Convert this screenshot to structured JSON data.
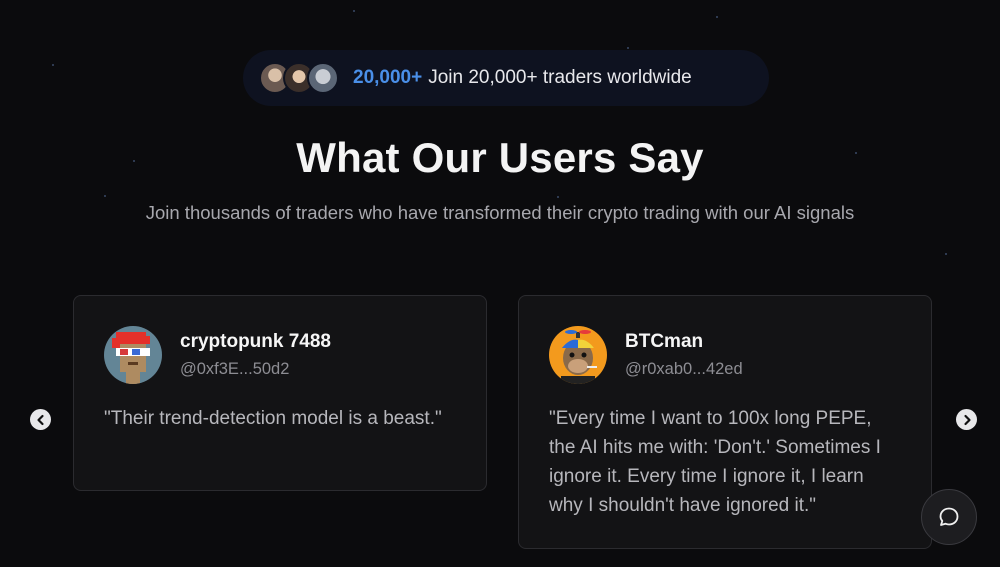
{
  "badge": {
    "count": "20,000+",
    "text": "Join 20,000+ traders worldwide",
    "avatars": [
      "user-avatar-1",
      "user-avatar-2",
      "user-avatar-3"
    ]
  },
  "heading": {
    "title": "What Our Users Say",
    "subtitle": "Join thousands of traders who have transformed their crypto trading with our AI signals"
  },
  "testimonials": [
    {
      "name": "cryptopunk 7488",
      "handle": "@0xf3E...50d2",
      "quote": "\"Their trend-detection model is a beast.\""
    },
    {
      "name": "BTCman",
      "handle": "@r0xab0...42ed",
      "quote": "\"Every time I want to 100x long PEPE, the AI hits me with: 'Don't.' Sometimes I ignore it. Every time I ignore it, I learn why I shouldn't have ignored it.\""
    }
  ],
  "controls": {
    "prev_icon": "chevron-left-icon",
    "next_icon": "chevron-right-icon",
    "chat_icon": "chat-bubble-icon"
  },
  "colors": {
    "background": "#0b0b0d",
    "accent": "#4a8fe8",
    "card": "#131315"
  }
}
